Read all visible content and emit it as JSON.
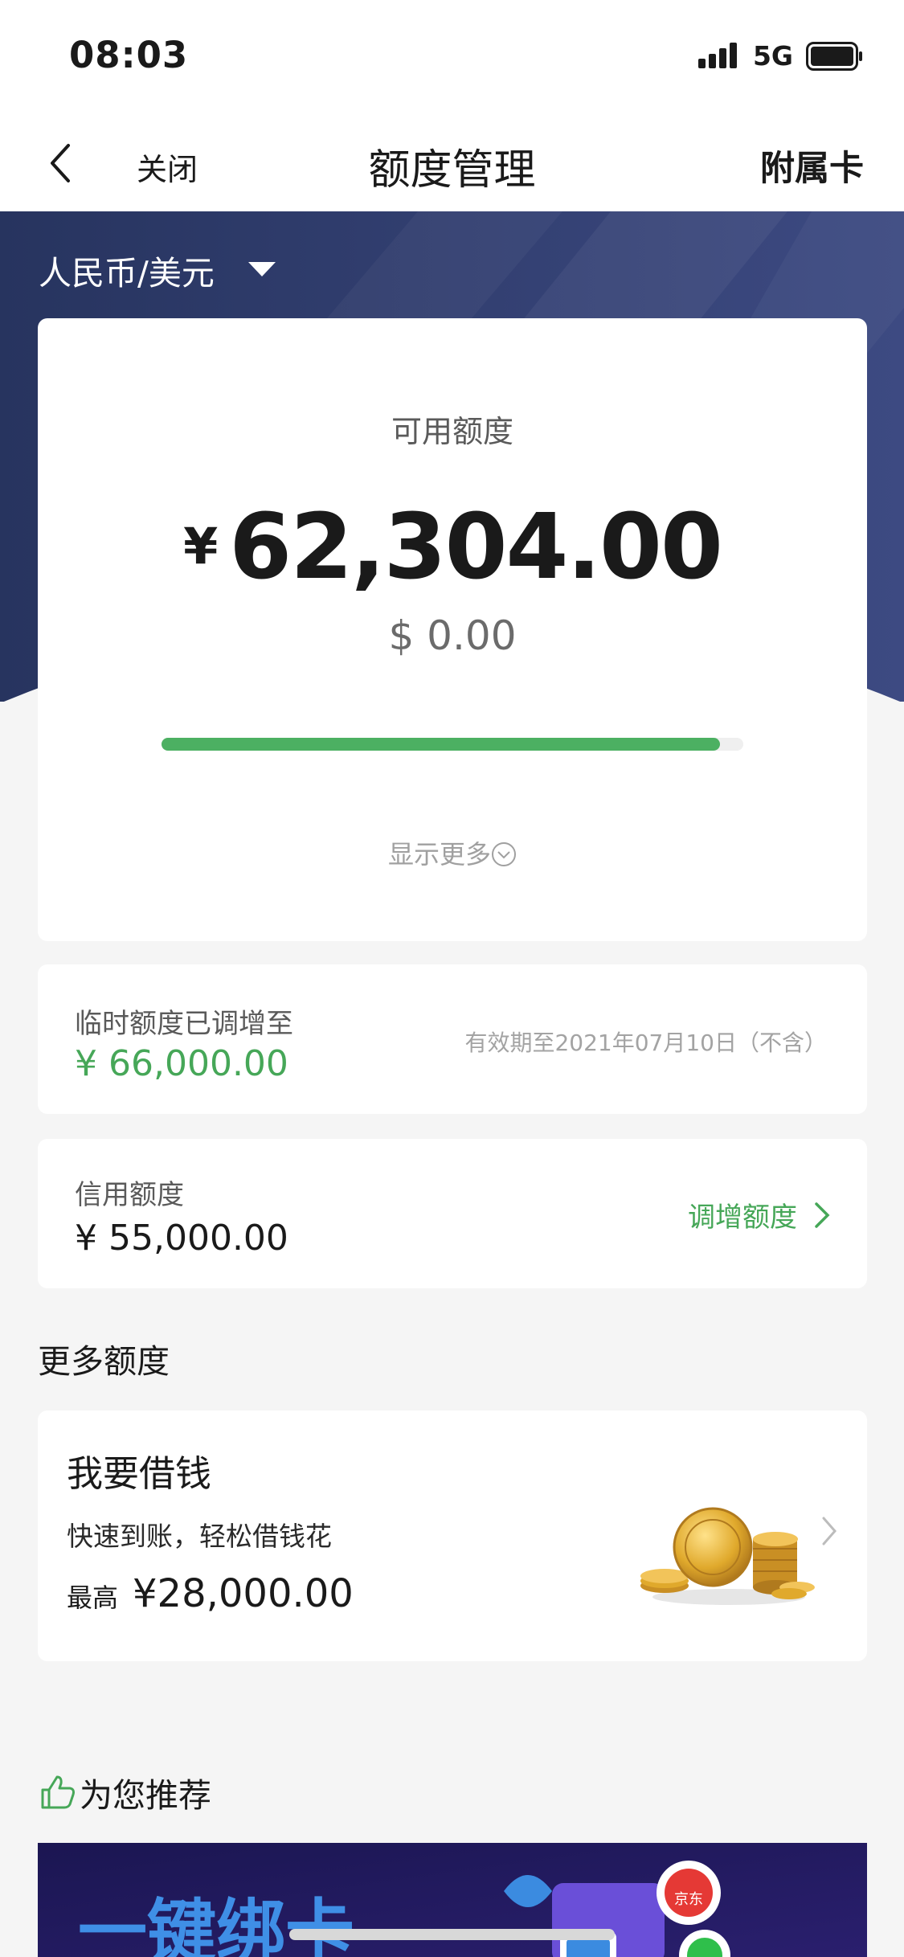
{
  "status_bar": {
    "time": "08:03",
    "network": "5G"
  },
  "nav": {
    "close": "关闭",
    "title": "额度管理",
    "right_action": "附属卡"
  },
  "currency": {
    "selected": "人民币/美元"
  },
  "available": {
    "label": "可用额度",
    "currency_symbol": "¥",
    "amount": "62,304.00",
    "usd": "$ 0.00",
    "usage_fraction": 0.96,
    "show_more": "显示更多"
  },
  "temp_limit": {
    "label": "临时额度已调增至",
    "amount": "¥ 66,000.00",
    "validity": "有效期至2021年07月10日（不含）"
  },
  "credit_limit": {
    "label": "信用额度",
    "amount": "¥ 55,000.00",
    "action": "调增额度"
  },
  "more_section": {
    "title": "更多额度"
  },
  "loan": {
    "title": "我要借钱",
    "desc": "快速到账，轻松借钱花",
    "max_label": "最高",
    "max_amount": "¥28,000.00"
  },
  "recommend": {
    "title": "为您推荐"
  },
  "banner": {
    "text": "一键绑卡",
    "logo_text": "京东"
  },
  "colors": {
    "accent_green": "#46a758",
    "hero_navy": "#2e3b6d",
    "progress": "#4cb062"
  }
}
